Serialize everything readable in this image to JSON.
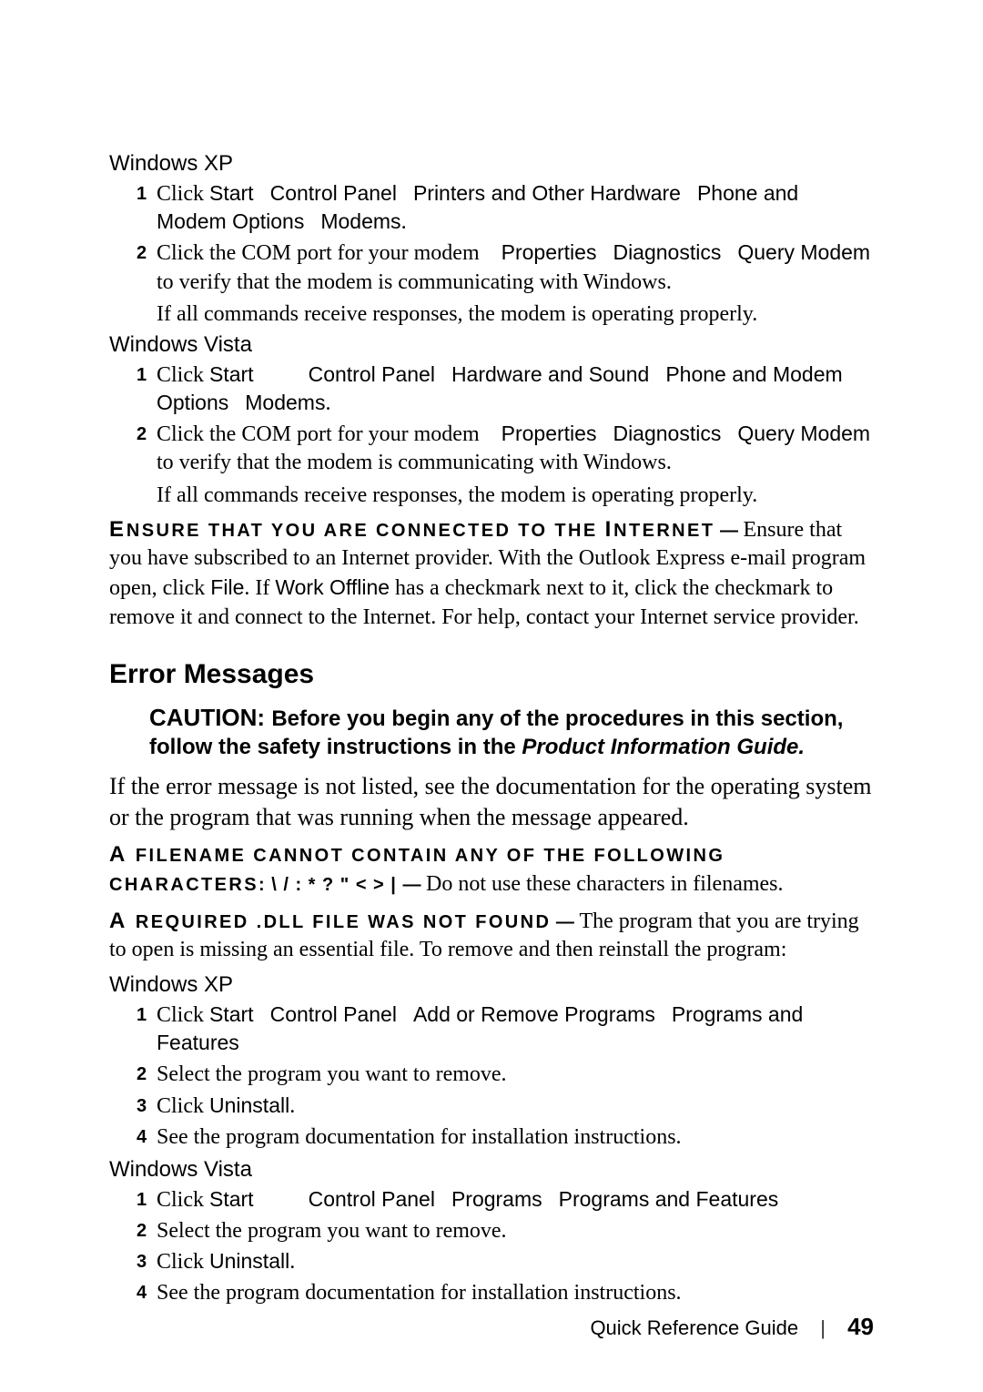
{
  "os1": {
    "heading": "Windows XP",
    "steps": [
      {
        "num": "1",
        "prefix": "Click ",
        "path": [
          "Start",
          "Control Panel",
          "Printers and Other Hardware",
          "Phone and Modem Options",
          "Modems"
        ],
        "suffix": "."
      },
      {
        "num": "2",
        "prefix": "Click the COM port for your modem ",
        "path": [
          "Properties",
          "Diagnostics",
          "Query Modem"
        ],
        "suffix": " to verify that the modem is communicating with Windows."
      }
    ],
    "result": "If all commands receive responses, the modem is operating properly."
  },
  "os2": {
    "heading": "Windows Vista",
    "steps": [
      {
        "num": "1",
        "prefix": "Click ",
        "path": [
          "Start",
          "Control Panel",
          "Hardware and Sound",
          "Phone and Modem Options",
          "Modems"
        ],
        "suffix": "."
      },
      {
        "num": "2",
        "prefix": "Click the COM port for your modem ",
        "path": [
          "Properties",
          "Diagnostics",
          "Query Modem"
        ],
        "suffix": " to verify that the modem is communicating with Windows."
      }
    ],
    "result": "If all commands receive responses, the modem is operating properly."
  },
  "ensure": {
    "leadA": "E",
    "leadB": "NSURE THAT YOU ARE CONNECTED TO THE ",
    "leadC": "I",
    "leadD": "NTERNET",
    "dash": " — ",
    "body1": "Ensure that you have subscribed to an Internet provider. With the Outlook Express e-mail program open, click ",
    "file": "File",
    "body2": ". If ",
    "work": "Work Offline",
    "body3": " has a checkmark next to it, click the checkmark to remove it and connect to the Internet. For help, contact your Internet service provider."
  },
  "error_section_title": "Error Messages",
  "caution": {
    "label": "CAUTION: ",
    "text1": "Before you begin any of the procedures in this section, follow the safety instructions in the ",
    "italic": "Product Information Guide.",
    "text2": ""
  },
  "error_intro": "If the error message is not listed, see the documentation for the operating system or the program that was running when the message appeared.",
  "filename_msg": {
    "leadA": "A ",
    "leadB": "FILENAME CANNOT CONTAIN ANY OF THE FOLLOWING CHARACTERS",
    "chars": ": \\ / : * ? \" < > | ",
    "dash": "— ",
    "body": "Do not use these characters in filenames."
  },
  "dll_msg": {
    "leadA": "A ",
    "leadB": "REQUIRED ",
    "dll": ".DLL ",
    "leadC": "FILE WAS NOT FOUND",
    "dash": " — ",
    "body": "The program that you are trying to open is missing an essential file. To remove and then reinstall the program:"
  },
  "uninstall_xp": {
    "heading": "Windows XP",
    "s1_prefix": "Click ",
    "s1_path": [
      "Start",
      "Control Panel",
      "Add or Remove Programs",
      "Programs and Features"
    ],
    "s2": "Select the program you want to remove.",
    "s3_prefix": "Click ",
    "s3_term": "Uninstall",
    "s3_suffix": ".",
    "s4": "See the program documentation for installation instructions."
  },
  "uninstall_vista": {
    "heading": "Windows Vista",
    "s1_prefix": "Click ",
    "s1_path": [
      "Start",
      "Control Panel",
      "Programs",
      "Programs and Features"
    ],
    "s2": "Select the program you want to remove.",
    "s3_prefix": "Click ",
    "s3_term": "Uninstall",
    "s3_suffix": ".",
    "s4": "See the program documentation for installation instructions."
  },
  "footer": {
    "title": "Quick Reference Guide",
    "page": "49"
  }
}
